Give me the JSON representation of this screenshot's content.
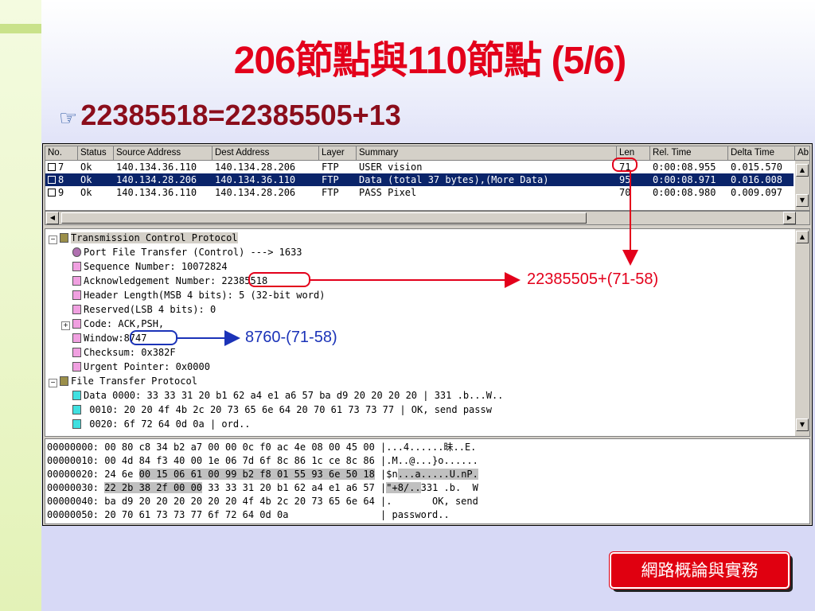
{
  "slide": {
    "title": "206節點與110節點 (5/6)",
    "bullet": "22385518=22385505+13",
    "footer": "網路概論與實務"
  },
  "packet_list": {
    "columns": [
      "No.",
      "Status",
      "Source Address",
      "Dest Address",
      "Layer",
      "Summary",
      "Len",
      "Rel. Time",
      "Delta Time",
      "Ab"
    ],
    "rows": [
      [
        "7",
        "Ok",
        "140.134.36.110",
        "140.134.28.206",
        "FTP",
        "USER vision",
        "71",
        "0:00:08.955",
        "0.015.570"
      ],
      [
        "8",
        "Ok",
        "140.134.28.206",
        "140.134.36.110",
        "FTP",
        "Data (total 37 bytes),(More Data)",
        "95",
        "0:00:08.971",
        "0.016.008"
      ],
      [
        "9",
        "Ok",
        "140.134.36.110",
        "140.134.28.206",
        "FTP",
        "PASS Pixel",
        "70",
        "0:00:08.980",
        "0.009.097"
      ]
    ],
    "selected_row": 1
  },
  "decode_tree": {
    "tcp": "Transmission Control Protocol",
    "port": "Port File Transfer (Control) ---> 1633",
    "seq": "Sequence Number: 10072824",
    "ack_label": "Acknowledgement Number: ",
    "ack_value": "22385518",
    "header_len": "Header Length(MSB 4 bits): 5 (32-bit word)",
    "reserved": "Reserved(LSB 4 bits): 0",
    "code": "Code: ACK,PSH,",
    "window_label": "Window:",
    "window_value": "8747",
    "checksum": "Checksum: 0x382F",
    "urgent": "Urgent Pointer: 0x0000",
    "ftp": "File Transfer Protocol",
    "data0": "Data 0000: 33 33 31 20 b1 62 a4 e1 a6 57 ba d9 20 20 20 20 | 331 .b...W..",
    "data1": "     0010: 20 20 4f 4b 2c 20 73 65 6e 64 20 70 61 73 73 77 |    OK, send passw",
    "data2": "     0020: 6f 72 64 0d 0a                                  | ord.."
  },
  "hex_dump": {
    "l0": "00000000: 00 80 c8 34 b2 a7 00 00 0c f0 ac 4e 08 00 45 00 |...4......昧..E.",
    "l1": "00000010: 00 4d 84 f3 40 00 1e 06 7d 6f 8c 86 1c ce 8c 86 |.M..@...}o......",
    "l2a": "00000020: 24 6e ",
    "l2b": "00 15 06 61 00 99 b2 f8 01 55 93 6e 50 18",
    "l2c": " |$n",
    "l2d": "...a.....U.nP.",
    "l3a": "00000030: ",
    "l3b": "22 2b 38 2f 00 00",
    "l3c": " 33 33 31 20 b1 62 a4 e1 a6 57 |",
    "l3d": "\"+8/..",
    "l3e": "331 .b.  W",
    "l4": "00000040: ba d9 20 20 20 20 20 20 4f 4b 2c 20 73 65 6e 64 |.       OK, send",
    "l5": "00000050: 20 70 61 73 73 77 6f 72 64 0d 0a                | password.."
  },
  "annotations": {
    "ack_calc": "22385505+(71-58)",
    "window_calc": "8760-(71-58)"
  },
  "colors": {
    "title_red": "#e3001b",
    "bullet_maroon": "#8b0d1b",
    "annotation_blue": "#1b33b8",
    "selection_navy": "#0a246a"
  }
}
